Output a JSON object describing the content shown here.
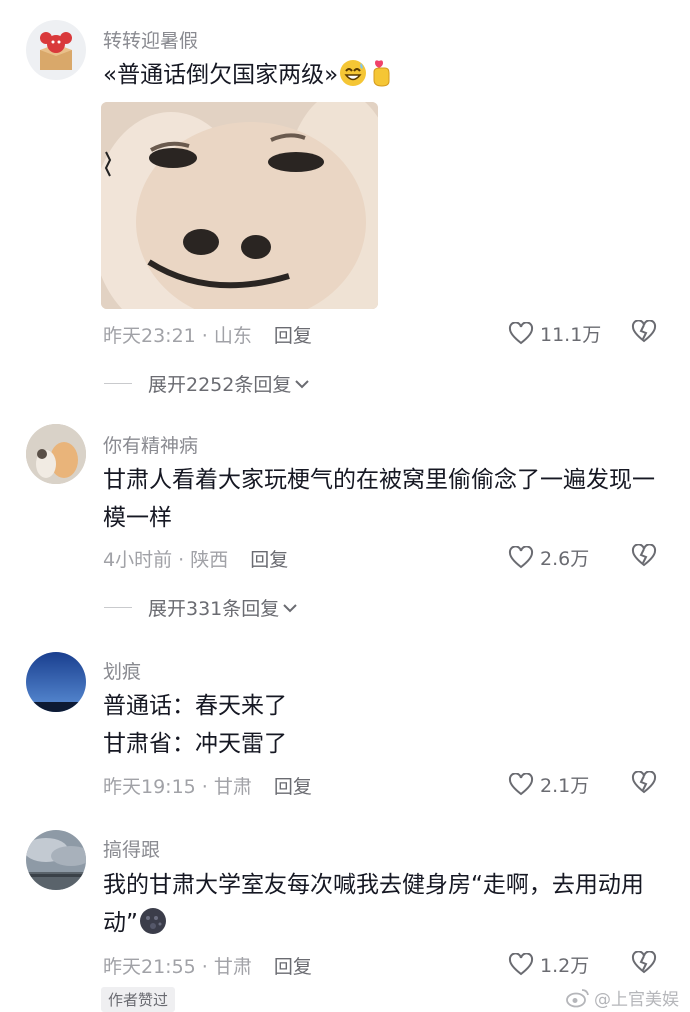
{
  "comments": [
    {
      "username": "转转迎暑假",
      "text": "«普通话倒欠国家两级»",
      "time": "昨天23:21 · 山东",
      "reply": "回复",
      "likes": "11.1万",
      "expand": "展开2252条回复"
    },
    {
      "username": "你有精神病",
      "text": "甘肃人看着大家玩梗气的在被窝里偷偷念了一遍发现一模一样",
      "time": "4小时前 · 陕西",
      "reply": "回复",
      "likes": "2.6万",
      "expand": "展开331条回复"
    },
    {
      "username": "划痕",
      "lines": [
        "普通话：春天来了",
        "甘肃省：冲天雷了"
      ],
      "time": "昨天19:15 · 甘肃",
      "reply": "回复",
      "likes": "2.1万"
    },
    {
      "username": "搞得跟",
      "text": "我的甘肃大学室友每次喊我去健身房“走啊，去用动用动”",
      "time": "昨天21:55 · 甘肃",
      "reply": "回复",
      "likes": "1.2万",
      "badge": "作者赞过"
    }
  ],
  "watermark": "@上官美娱",
  "icons": [
    "heart-icon",
    "broken-heart-icon",
    "chevron-down-icon",
    "weibo-logo-icon"
  ]
}
